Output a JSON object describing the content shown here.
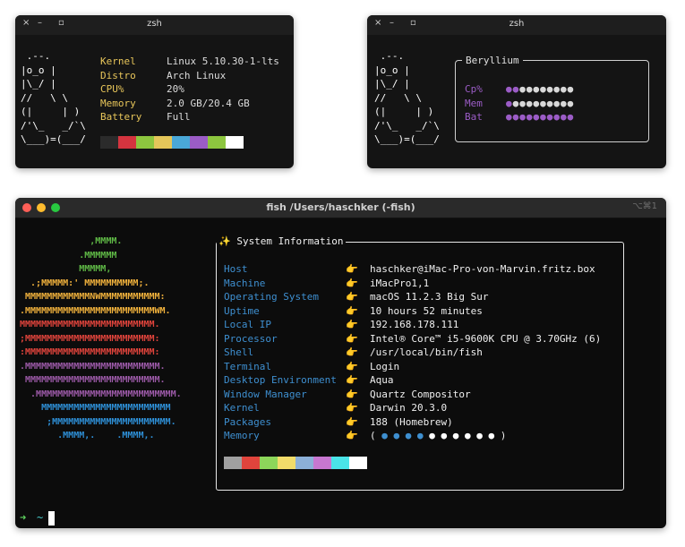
{
  "win1": {
    "controls": {
      "close": "×",
      "min": "–",
      "max": "▫"
    },
    "title": "zsh",
    "tux": [
      " .--.",
      "|o_o |",
      "|\\_/ |",
      "//   \\ \\",
      "(|     | )",
      "/'\\_   _/`\\",
      "\\___)=(___/"
    ],
    "info": [
      {
        "key": "Kernel",
        "value": "Linux 5.10.30-1-lts"
      },
      {
        "key": "Distro",
        "value": "Arch Linux"
      },
      {
        "key": "CPU%",
        "value": "20%"
      },
      {
        "key": "Memory",
        "value": "2.0 GB/20.4 GB"
      },
      {
        "key": "Battery",
        "value": "Full"
      }
    ],
    "palette": [
      "#2b2b2b",
      "#d4343f",
      "#8dc63f",
      "#e4c65a",
      "#4aa8d8",
      "#9b5cc6",
      "#8dc63f",
      "#ffffff"
    ]
  },
  "win2": {
    "controls": {
      "close": "×",
      "min": "–",
      "max": "▫"
    },
    "title": "zsh",
    "tux": [
      " .--.",
      "|o_o |",
      "|\\_/ |",
      "//   \\ \\",
      "(|     | )",
      "/'\\_   _/`\\",
      "\\___)=(___/"
    ],
    "box_title": "Beryllium",
    "rows": [
      {
        "key": "Cp%",
        "dots": "●●●●●●●●●●",
        "filled": 2
      },
      {
        "key": "Mem",
        "dots": "●●●●●●●●●●",
        "filled": 1
      },
      {
        "key": "Bat",
        "dots": "●●●●●●●●●●",
        "filled": 10
      }
    ],
    "colors": {
      "accent": "#9b5cc6",
      "empty": "#d8d8d8"
    }
  },
  "win3": {
    "title": "fish /Users/haschker (-fish)",
    "shortcut": "⌥⌘1",
    "apple": [
      {
        "text": "             ,MMMM.",
        "color": "#5fb946"
      },
      {
        "text": "           .MMMMMM",
        "color": "#5fb946"
      },
      {
        "text": "           MMMMM,",
        "color": "#5fb946"
      },
      {
        "text": "  .;MMMMM:' MMMMMMMMMM;.",
        "color": "#f0b13c"
      },
      {
        "text": " MMMMMMMMMMMMNWMMMMMMMMMMM:",
        "color": "#f0b13c"
      },
      {
        "text": ".MMMMMMMMMMMMMMMMMMMMMMMMWM.",
        "color": "#f0b13c"
      },
      {
        "text": "MMMMMMMMMMMMMMMMMMMMMMMMM.",
        "color": "#e0443c"
      },
      {
        "text": ";MMMMMMMMMMMMMMMMMMMMMMMM:",
        "color": "#e0443c"
      },
      {
        "text": ":MMMMMMMMMMMMMMMMMMMMMMMM:",
        "color": "#e0443c"
      },
      {
        "text": ".MMMMMMMMMMMMMMMMMMMMMMMMM.",
        "color": "#9c5aa8"
      },
      {
        "text": " MMMMMMMMMMMMMMMMMMMMMMMMM.",
        "color": "#9c5aa8"
      },
      {
        "text": "  .MMMMMMMMMMMMMMMMMMMMMMMMMM.",
        "color": "#9c5aa8"
      },
      {
        "text": "    MMMMMMMMMMMMMMMMMMMMMMMM",
        "color": "#2e8fd6"
      },
      {
        "text": "     ;MMMMMMMMMMMMMMMMMMMMMM.",
        "color": "#2e8fd6"
      },
      {
        "text": "       .MMMM,.    .MMMM,.",
        "color": "#2e8fd6"
      }
    ],
    "box_title": "✨ System Information",
    "pointer": "👉",
    "info": [
      {
        "key": "Host",
        "value": "haschker@iMac-Pro-von-Marvin.fritz.box"
      },
      {
        "key": "Machine",
        "value": "iMacPro1,1"
      },
      {
        "key": "Operating System",
        "value": "macOS 11.2.3 Big Sur"
      },
      {
        "key": "Uptime",
        "value": "10 hours 52 minutes"
      },
      {
        "key": "Local IP",
        "value": "192.168.178.111"
      },
      {
        "key": "Processor",
        "value": "Intel® Core™ i5-9600K CPU @ 3.70GHz (6)"
      },
      {
        "key": "Shell",
        "value": "/usr/local/bin/fish"
      },
      {
        "key": "Terminal",
        "value": "Login"
      },
      {
        "key": "Desktop Environment",
        "value": "Aqua"
      },
      {
        "key": "Window Manager",
        "value": "Quartz Compositor"
      },
      {
        "key": "Kernel",
        "value": "Darwin 20.3.0"
      },
      {
        "key": "Packages",
        "value": "188 (Homebrew)"
      },
      {
        "key": "Memory",
        "value": ""
      }
    ],
    "memory_dots": {
      "open": "(",
      "close": ")",
      "total": 10,
      "filled": 4,
      "fill_color": "#3e8fd0",
      "empty_color": "#ffffff"
    },
    "palette": [
      "#a0a0a0",
      "#e0443c",
      "#8dd65a",
      "#f2dc6a",
      "#8cb0d8",
      "#c777d0",
      "#4ae4e8",
      "#ffffff"
    ],
    "prompt": {
      "arrow": "➜",
      "dir": "~"
    }
  }
}
